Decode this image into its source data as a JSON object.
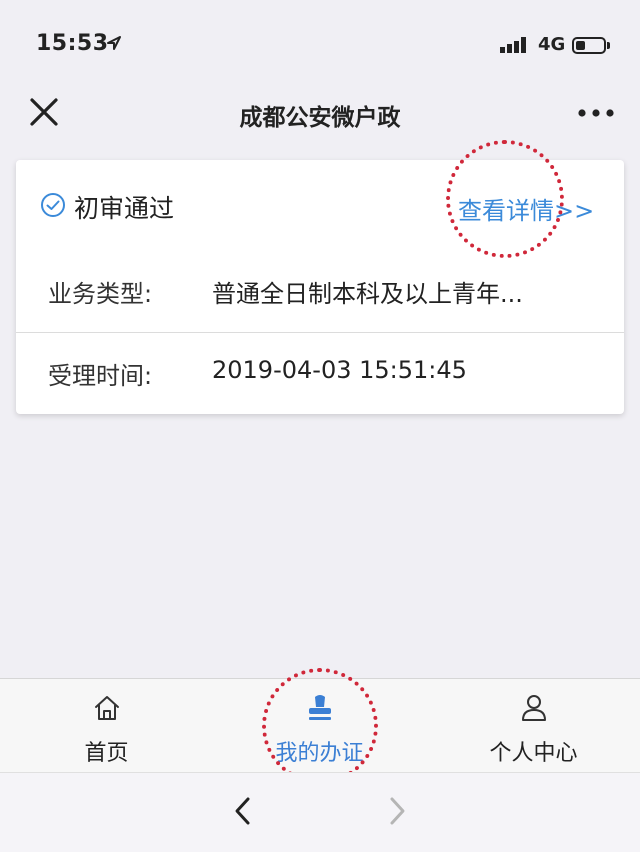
{
  "status_bar": {
    "time": "15:53",
    "network": "4G"
  },
  "nav": {
    "title": "成都公安微户政"
  },
  "card": {
    "status": "初审通过",
    "detail_link": "查看详情>>",
    "rows": [
      {
        "label": "业务类型:",
        "value": "普通全日制本科及以上青年..."
      },
      {
        "label": "受理时间:",
        "value": "2019-04-03 15:51:45"
      }
    ]
  },
  "tabs": [
    {
      "label": "首页",
      "icon": "home-icon"
    },
    {
      "label": "我的办证",
      "icon": "stamp-icon",
      "active": true
    },
    {
      "label": "个人中心",
      "icon": "person-icon"
    }
  ],
  "colors": {
    "accent": "#3b7fd4",
    "link": "#3b8ad9",
    "annotation": "#d0283a",
    "background": "#f0eff4"
  }
}
